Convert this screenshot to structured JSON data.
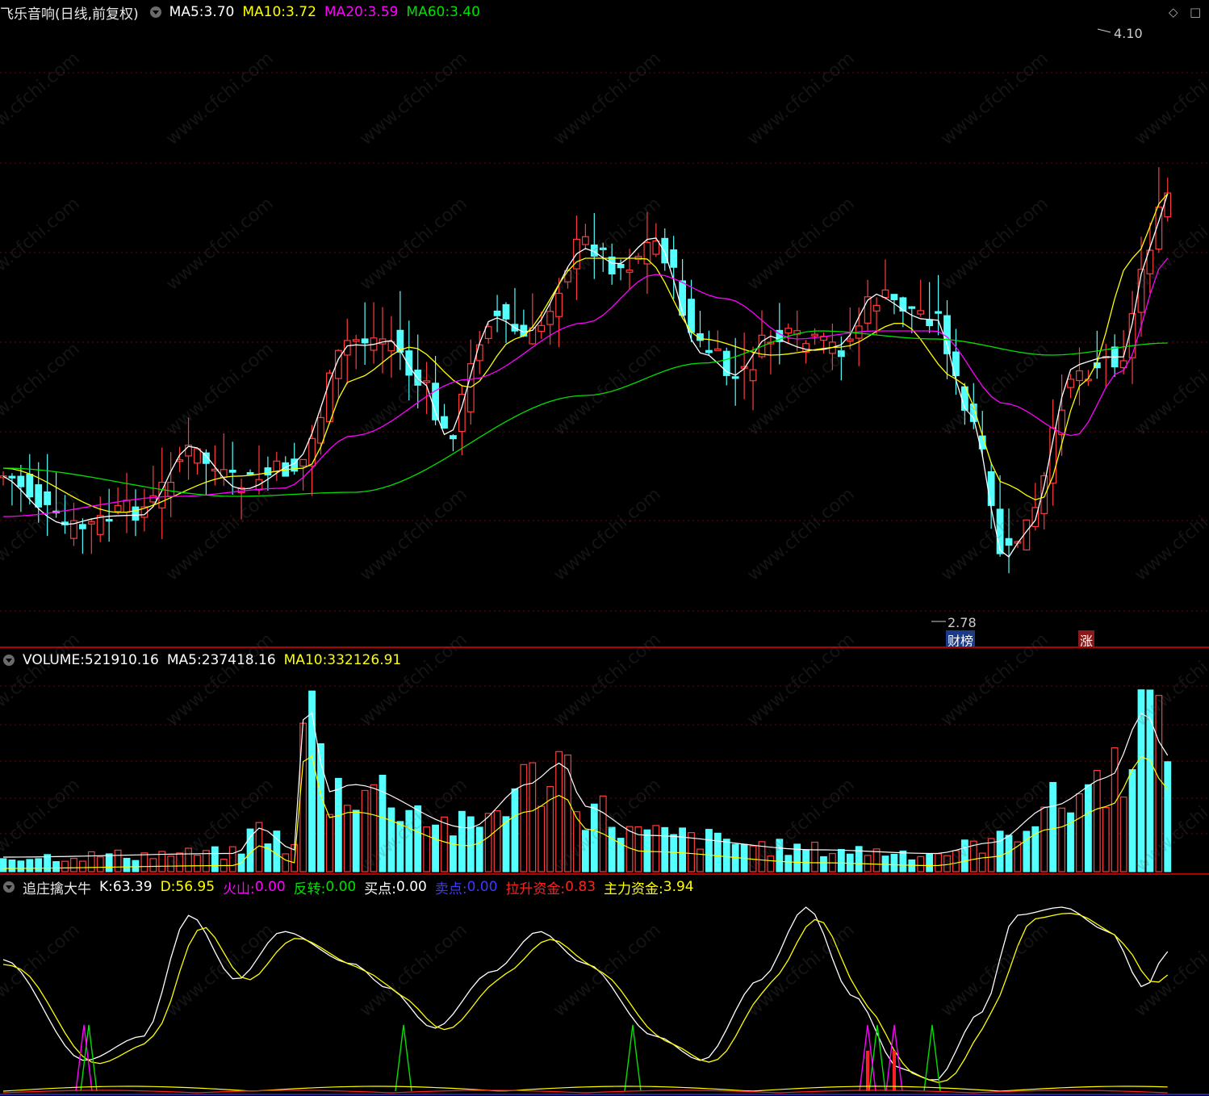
{
  "price_header": {
    "title": "飞乐音响(日线,前复权)",
    "ma5_label": "MA5: ",
    "ma5_value": "3.70",
    "ma10_label": "MA10: ",
    "ma10_value": "3.72",
    "ma20_label": "MA20: ",
    "ma20_value": "3.59",
    "ma60_label": "MA60: ",
    "ma60_value": "3.40"
  },
  "price_annotations": {
    "high": "4.10",
    "low": "2.78",
    "tag_rank": "财榜",
    "tag_up": "涨"
  },
  "corner_icons": {
    "diamond": "◇",
    "box": "□"
  },
  "volume_header": {
    "volume_label": "VOLUME: ",
    "volume_value": "521910.16",
    "ma5_label": "MA5: ",
    "ma5_value": "237418.16",
    "ma10_label": "MA10: ",
    "ma10_value": "332126.91"
  },
  "indicator_header": {
    "name": "追庄擒大牛",
    "k_label": "K: ",
    "k_value": "63.39",
    "d_label": "D: ",
    "d_value": "56.95",
    "huoshan_label": "火山: ",
    "huoshan_value": "0.00",
    "fanzhuan_label": "反转: ",
    "fanzhuan_value": "0.00",
    "maidian_label": "买点: ",
    "maidian_value": "0.00",
    "maichu_label": "卖点: ",
    "maichu_value": "0.00",
    "lasheng_label": "拉升资金: ",
    "lasheng_value": "0.83",
    "zhuli_label": "主力资金: ",
    "zhuli_value": "3.94"
  },
  "watermark": "www.cfchi.com",
  "colors": {
    "up": "#ff3c3c",
    "down": "#54ffff",
    "ma5": "#ffffff",
    "ma10": "#ffff00",
    "ma20": "#ff00ff",
    "ma60": "#00e000",
    "grid": "#7a0000",
    "sep": "#b00000"
  }
}
